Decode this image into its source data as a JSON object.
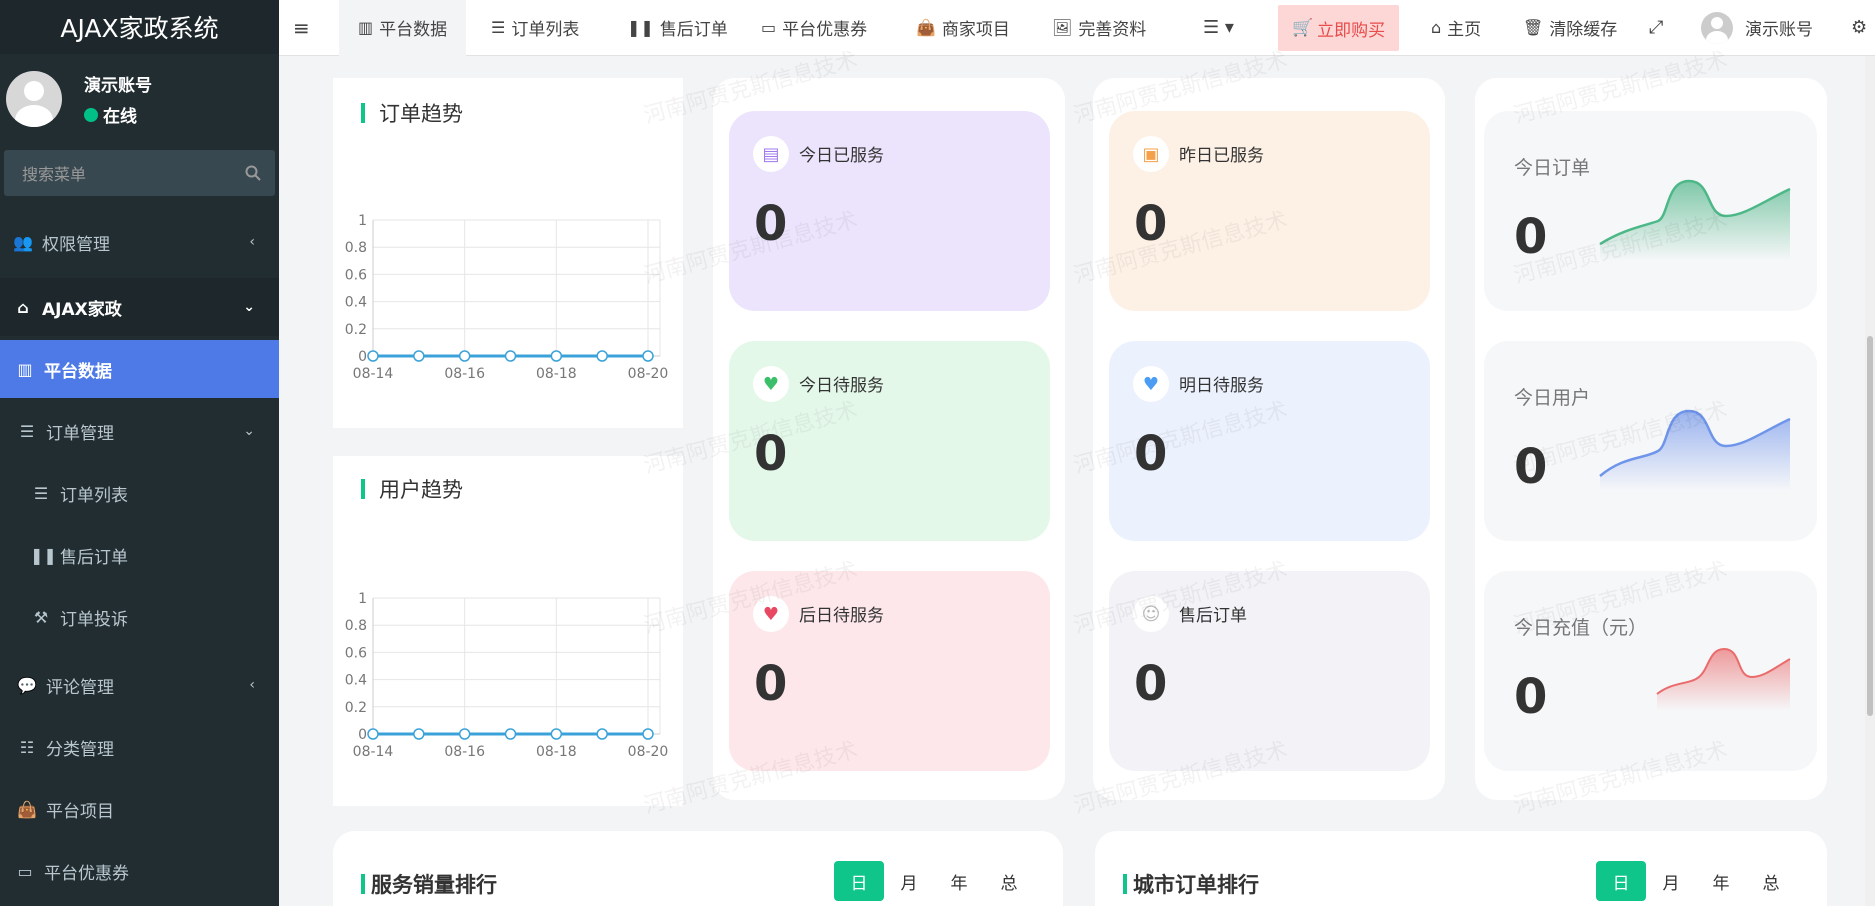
{
  "sidebar": {
    "brand": "AJAX家政系统",
    "user_name": "演示账号",
    "user_status": "在线",
    "search_placeholder": "搜索菜单",
    "items": [
      {
        "label": "权限管理",
        "icon": "users-icon"
      },
      {
        "label": "AJAX家政",
        "icon": "home-icon"
      },
      {
        "label": "平台数据",
        "icon": "bar-chart-icon"
      },
      {
        "label": "订单管理",
        "icon": "list-icon"
      },
      {
        "label": "订单列表",
        "icon": "list-icon"
      },
      {
        "label": "售后订单",
        "icon": "pause-icon"
      },
      {
        "label": "订单投诉",
        "icon": "gavel-icon"
      },
      {
        "label": "评论管理",
        "icon": "comments-icon"
      },
      {
        "label": "分类管理",
        "icon": "sliders-icon"
      },
      {
        "label": "平台项目",
        "icon": "shopping-bag-icon"
      },
      {
        "label": "平台优惠券",
        "icon": "credit-card-icon"
      }
    ]
  },
  "topbar": {
    "tabs": [
      "平台数据",
      "订单列表",
      "售后订单",
      "平台优惠券",
      "商家项目",
      "完善资料"
    ],
    "buy": "立即购买",
    "home": "主页",
    "clear_cache": "清除缓存",
    "account": "演示账号"
  },
  "order_trend": {
    "title": "订单趋势",
    "yticks": [
      "1",
      "0.8",
      "0.6",
      "0.4",
      "0.2",
      "0"
    ],
    "xticks": [
      "08-14",
      "08-16",
      "08-18",
      "08-20"
    ]
  },
  "user_trend": {
    "title": "用户趋势",
    "yticks": [
      "1",
      "0.8",
      "0.6",
      "0.4",
      "0.2",
      "0"
    ],
    "xticks": [
      "08-14",
      "08-16",
      "08-18",
      "08-20"
    ]
  },
  "chart_data": [
    {
      "type": "line",
      "title": "订单趋势",
      "x": [
        "08-14",
        "08-15",
        "08-16",
        "08-17",
        "08-18",
        "08-19",
        "08-20"
      ],
      "values": [
        0,
        0,
        0,
        0,
        0,
        0,
        0
      ],
      "ylim": [
        0,
        1
      ]
    },
    {
      "type": "line",
      "title": "用户趋势",
      "x": [
        "08-14",
        "08-15",
        "08-16",
        "08-17",
        "08-18",
        "08-19",
        "08-20"
      ],
      "values": [
        0,
        0,
        0,
        0,
        0,
        0,
        0
      ],
      "ylim": [
        0,
        1
      ]
    }
  ],
  "stats": [
    {
      "label": "今日已服务",
      "value": "0"
    },
    {
      "label": "昨日已服务",
      "value": "0"
    },
    {
      "label": "今日待服务",
      "value": "0"
    },
    {
      "label": "明日待服务",
      "value": "0"
    },
    {
      "label": "后日待服务",
      "value": "0"
    },
    {
      "label": "售后订单",
      "value": "0"
    }
  ],
  "minis": [
    {
      "label": "今日订单",
      "value": "0"
    },
    {
      "label": "今日用户",
      "value": "0"
    },
    {
      "label": "今日充值（元）",
      "value": "0"
    }
  ],
  "ranks": [
    {
      "title": "服务销量排行",
      "options": [
        "日",
        "月",
        "年",
        "总"
      ]
    },
    {
      "title": "城市订单排行",
      "options": [
        "日",
        "月",
        "年",
        "总"
      ]
    }
  ],
  "watermark": "河南阿贾克斯信息技术"
}
